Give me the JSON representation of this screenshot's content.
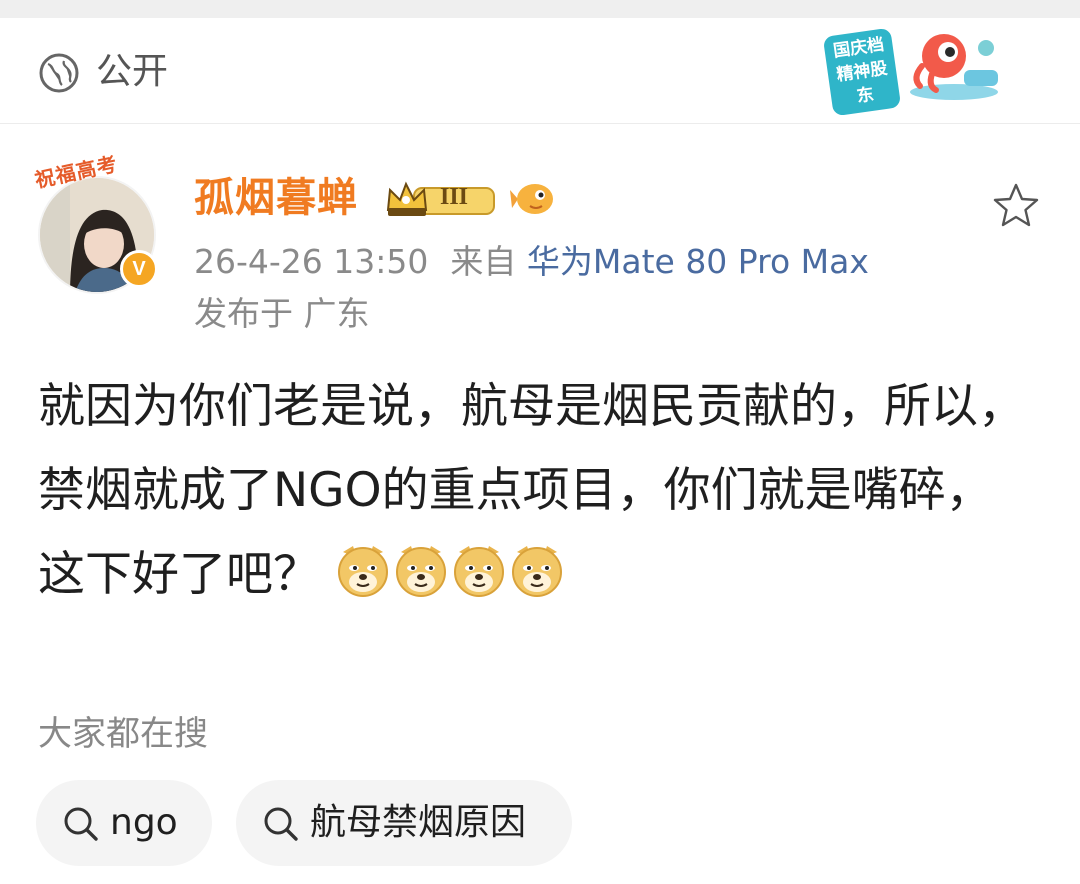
{
  "visibility": {
    "label": "公开",
    "icon": "globe-icon"
  },
  "promo": {
    "line1": "国庆档",
    "line2": "精神股东"
  },
  "author": {
    "avatar_ribbon": "祝福高考",
    "name": "孤烟暮蝉",
    "level_badge": "III",
    "verified": "V"
  },
  "meta": {
    "time": "26-4-26 13:50",
    "source_prefix": "来自",
    "device": "华为Mate 80 Pro Max",
    "location": "发布于 广东"
  },
  "post": {
    "text": "就因为你们老是说，航母是烟民贡献的，所以，禁烟就成了NGO的重点项目，你们就是嘴碎，这下好了吧？",
    "emoji_count": 4,
    "emoji": "doge-emoji"
  },
  "search": {
    "title": "大家都在搜",
    "chips": [
      {
        "label": "ngo"
      },
      {
        "label": "航母禁烟原因"
      }
    ]
  },
  "colors": {
    "username": "#f07b21",
    "device": "#4a6ba0",
    "meta": "#8a8a8a"
  }
}
